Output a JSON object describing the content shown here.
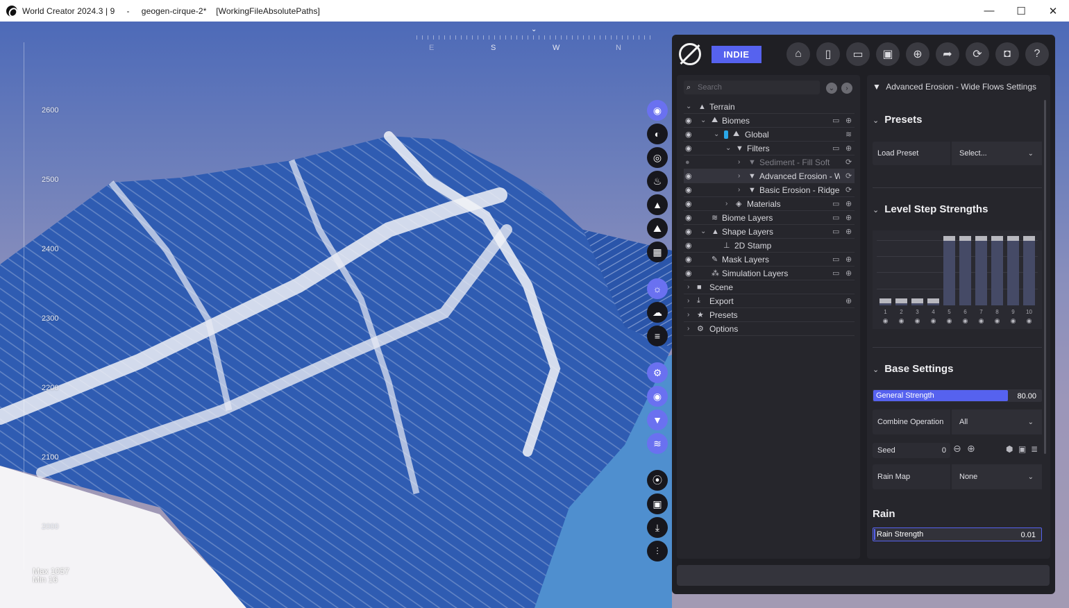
{
  "window": {
    "title": "World Creator 2024.3 | 9     -     geogen-cirque-2*    [WorkingFileAbsolutePaths]",
    "minimize": "—",
    "maximize": "☐",
    "close": "✕"
  },
  "viewport": {
    "ticks": [
      "2600",
      "2500",
      "2400",
      "2300",
      "2200",
      "2100",
      "2000"
    ],
    "max_label": "Max 1057",
    "min_label": "Min 16",
    "compass": {
      "e": "E",
      "s": "S",
      "w": "W",
      "n": "N"
    }
  },
  "toolbar": {
    "indie_label": "INDIE",
    "buttons": [
      "home",
      "new-file",
      "open-folder",
      "save",
      "save-add",
      "export",
      "refresh",
      "camera",
      "help"
    ]
  },
  "tree": {
    "search_placeholder": "Search",
    "rows": [
      {
        "label": "Terrain"
      },
      {
        "label": "Biomes"
      },
      {
        "label": "Global"
      },
      {
        "label": "Filters"
      },
      {
        "label": "Sediment - Fill Soft"
      },
      {
        "label": "Advanced Erosion - Wide Flows"
      },
      {
        "label": "Basic Erosion - Ridged"
      },
      {
        "label": "Materials"
      },
      {
        "label": "Biome Layers"
      },
      {
        "label": "Shape Layers"
      },
      {
        "label": "2D Stamp"
      },
      {
        "label": "Mask Layers"
      },
      {
        "label": "Simulation Layers"
      },
      {
        "label": "Scene"
      },
      {
        "label": "Export"
      },
      {
        "label": "Presets"
      },
      {
        "label": "Options"
      }
    ]
  },
  "props": {
    "header": "Advanced Erosion - Wide Flows Settings",
    "presets_title": "Presets",
    "load_preset_label": "Load Preset",
    "load_preset_value": "Select...",
    "level_title": "Level Step Strengths",
    "level_values": [
      0.1,
      0.1,
      0.1,
      0.1,
      1.0,
      1.0,
      1.0,
      1.0,
      1.0,
      1.0
    ],
    "level_labels": [
      "1",
      "2",
      "3",
      "4",
      "5",
      "6",
      "7",
      "8",
      "9",
      "10"
    ],
    "base_title": "Base Settings",
    "general_strength_label": "General Strength",
    "general_strength_value": "80.00",
    "general_strength_fraction": 0.8,
    "combine_label": "Combine Operation",
    "combine_value": "All",
    "seed_label": "Seed",
    "seed_value": "0",
    "rain_map_label": "Rain Map",
    "rain_map_value": "None",
    "rain_title": "Rain",
    "rain_strength_label": "Rain Strength",
    "rain_strength_value": "0.01",
    "rain_strength_fraction": 0.01
  },
  "colors": {
    "accent": "#5662ef",
    "panel_bg": "#1f1f24",
    "terrain_blue": "#2f5cb2"
  }
}
